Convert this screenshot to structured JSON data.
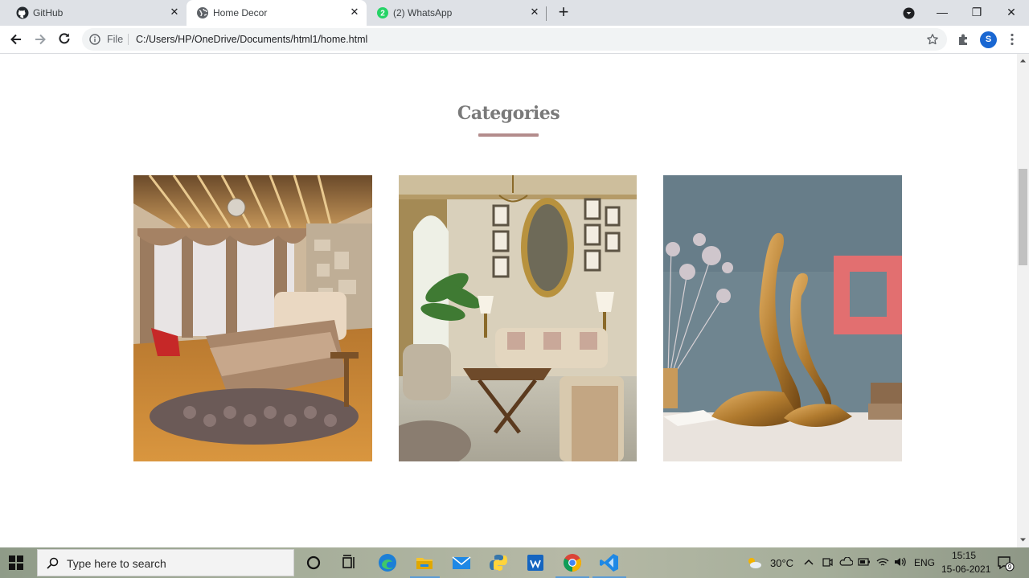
{
  "browser": {
    "tabs": [
      {
        "title": "GitHub",
        "icon": "github-icon",
        "active": false
      },
      {
        "title": "Home Decor",
        "icon": "globe-icon",
        "active": true
      },
      {
        "title": "(2) WhatsApp",
        "icon": "whatsapp-icon",
        "active": false,
        "badge": "2"
      }
    ],
    "close_glyph": "✕",
    "new_tab_glyph": "+",
    "window_controls": {
      "minimize": "—",
      "restore": "❐",
      "close": "✕"
    },
    "address": {
      "scheme_label": "File",
      "url": "C:/Users/HP/OneDrive/Documents/html1/home.html"
    },
    "profile_initial": "S"
  },
  "page": {
    "section_title": "Categories",
    "accent_color": "#b38c8c",
    "categories": [
      {
        "image": "bedroom-photo"
      },
      {
        "image": "living-room-photo"
      },
      {
        "image": "swan-decor-photo"
      }
    ]
  },
  "taskbar": {
    "search_placeholder": "Type here to search",
    "apps": [
      "cortana-icon",
      "task-view-icon",
      "edge-icon",
      "file-explorer-icon",
      "mail-icon",
      "python-icon",
      "whiteboard-icon",
      "chrome-icon",
      "vscode-icon"
    ],
    "weather": "30°C",
    "language": "ENG",
    "time": "15:15",
    "date": "15-06-2021",
    "notification_count": "9"
  }
}
